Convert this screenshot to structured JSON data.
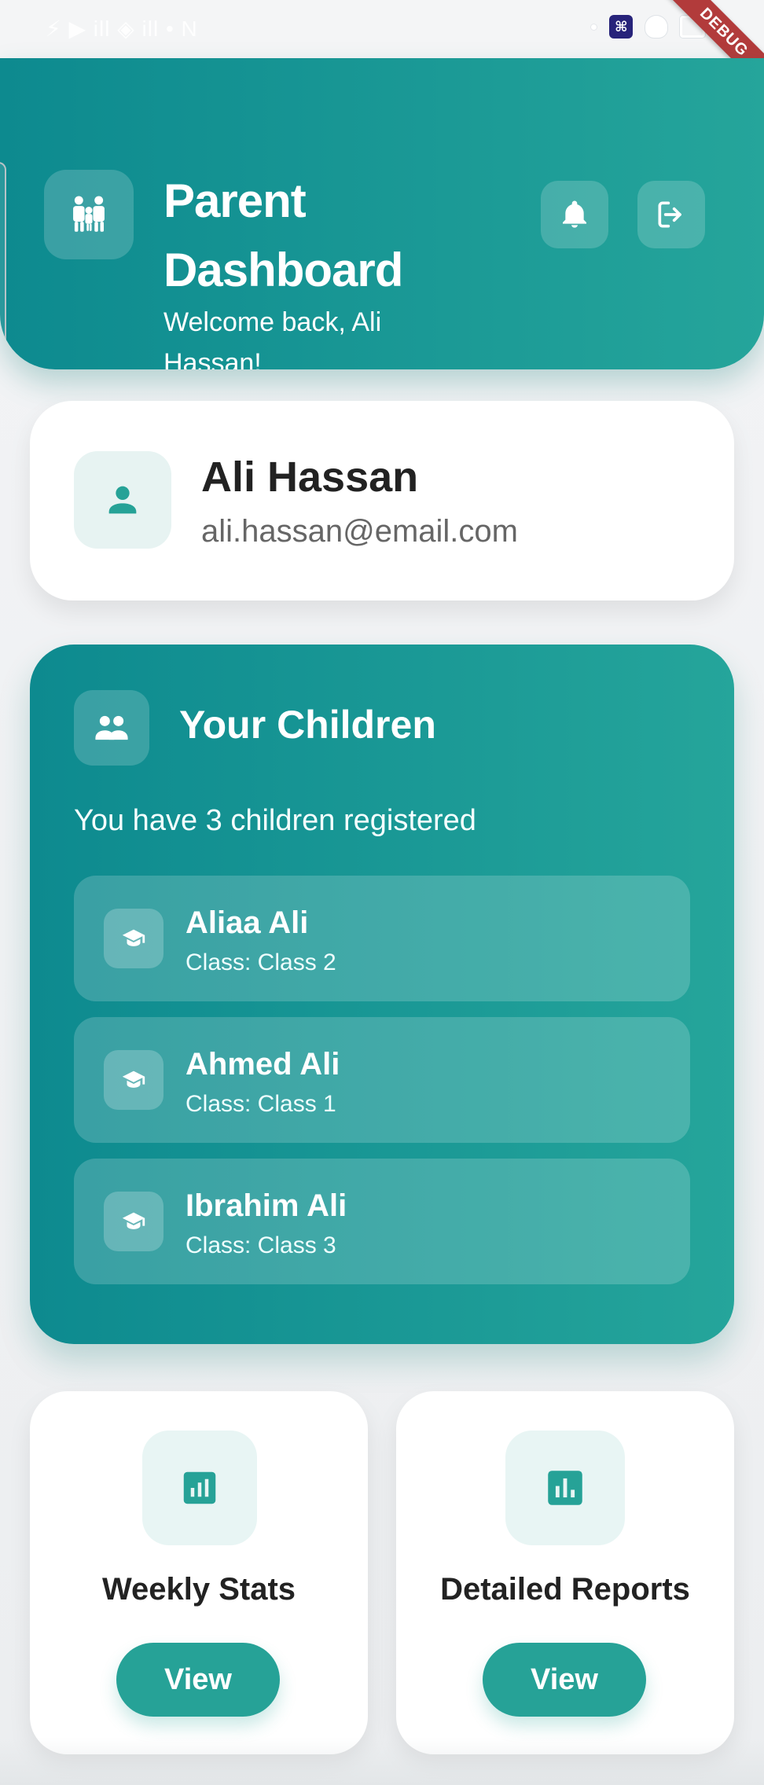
{
  "status_bar": {
    "left_text": "⚡ ▶ ill ◈ ill • N",
    "right_extra": "A"
  },
  "debug": {
    "label": "DEBUG"
  },
  "header": {
    "title": "Parent Dashboard",
    "subtitle": "Welcome back, Ali Hassan!",
    "icons": {
      "main": "family-icon",
      "notify": "bell-icon",
      "logout": "logout-icon"
    }
  },
  "profile": {
    "name": "Ali Hassan",
    "email": "ali.hassan@email.com",
    "icon": "person-icon"
  },
  "children": {
    "title": "Your Children",
    "count_text": "You have 3 children registered",
    "items": [
      {
        "name": "Aliaa Ali",
        "class": "Class: Class 2",
        "icon": "graduation-cap-icon"
      },
      {
        "name": "Ahmed Ali",
        "class": "Class: Class 1",
        "icon": "graduation-cap-icon"
      },
      {
        "name": "Ibrahim Ali",
        "class": "Class: Class 3",
        "icon": "graduation-cap-icon"
      }
    ],
    "header_icon": "group-icon"
  },
  "actions": [
    {
      "title": "Weekly Stats",
      "button": "View",
      "icon": "stats-icon"
    },
    {
      "title": "Detailed Reports",
      "button": "View",
      "icon": "bar-chart-icon"
    }
  ],
  "colors": {
    "teal_dark": "#0d8a8f",
    "teal": "#25a59b",
    "button_teal": "#26a297",
    "debug_red": "#b23b3b"
  }
}
